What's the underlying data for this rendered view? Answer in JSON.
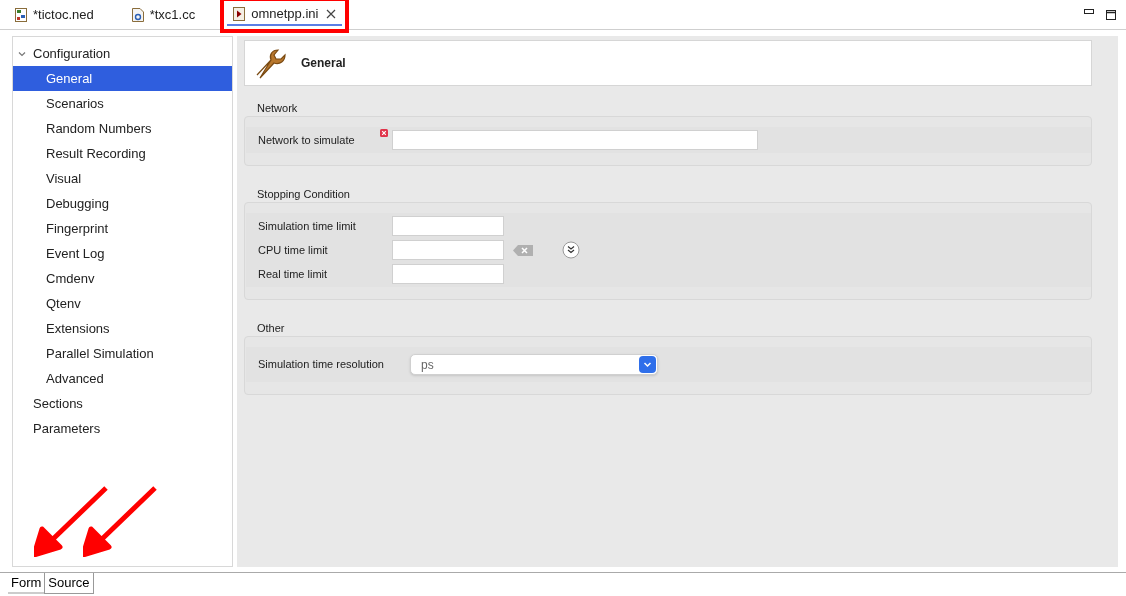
{
  "editor_tabs": [
    {
      "label": "*tictoc.ned",
      "selected": false,
      "highlighted": false,
      "closable": false
    },
    {
      "label": "*txc1.cc",
      "selected": false,
      "highlighted": false,
      "closable": false
    },
    {
      "label": "omnetpp.ini",
      "selected": true,
      "highlighted": true,
      "closable": true
    }
  ],
  "tree": [
    {
      "label": "Configuration",
      "expanded": true,
      "selected": false,
      "children": [
        {
          "label": "General",
          "selected": true
        },
        {
          "label": "Scenarios",
          "selected": false
        },
        {
          "label": "Random Numbers",
          "selected": false
        },
        {
          "label": "Result Recording",
          "selected": false
        },
        {
          "label": "Visual",
          "selected": false
        },
        {
          "label": "Debugging",
          "selected": false
        },
        {
          "label": "Fingerprint",
          "selected": false
        },
        {
          "label": "Event Log",
          "selected": false
        },
        {
          "label": "Cmdenv",
          "selected": false
        },
        {
          "label": "Qtenv",
          "selected": false
        },
        {
          "label": "Extensions",
          "selected": false
        },
        {
          "label": "Parallel Simulation",
          "selected": false
        },
        {
          "label": "Advanced",
          "selected": false
        }
      ]
    },
    {
      "label": "Sections",
      "selected": false
    },
    {
      "label": "Parameters",
      "selected": false
    }
  ],
  "page_title": "General",
  "groups": [
    {
      "title": "Network",
      "fields": [
        {
          "kind": "text",
          "label": "Network to simulate",
          "error": true,
          "wide": true,
          "actions": false
        }
      ]
    },
    {
      "title": "Stopping Condition",
      "fields": [
        {
          "kind": "text",
          "label": "Simulation time limit",
          "error": false,
          "wide": false,
          "actions": false
        },
        {
          "kind": "text",
          "label": "CPU time limit",
          "error": false,
          "wide": false,
          "actions": true
        },
        {
          "kind": "text",
          "label": "Real time limit",
          "error": false,
          "wide": false,
          "actions": false
        }
      ]
    },
    {
      "title": "Other",
      "fields": [
        {
          "kind": "select",
          "label": "Simulation time resolution",
          "value": "ps"
        }
      ]
    }
  ],
  "bottom_tabs": [
    {
      "label": "Form",
      "selected": true
    },
    {
      "label": "Source",
      "selected": false
    }
  ]
}
